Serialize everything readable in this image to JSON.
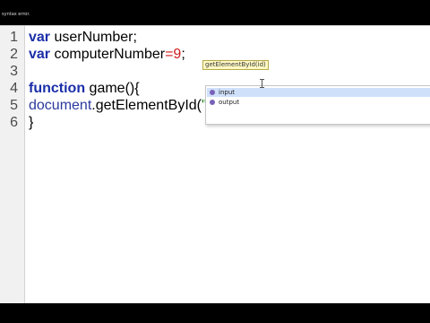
{
  "window": {
    "title_fragment": "syntax error."
  },
  "editor": {
    "line_numbers": [
      "1",
      "2",
      "3",
      "4",
      "5",
      "6"
    ],
    "lines": {
      "l1": {
        "kw": "var",
        "text": " userNumber;"
      },
      "l2": {
        "kw": "var",
        "ident": " computerNumber",
        "op": "=",
        "num": "9",
        "end": ";"
      },
      "l4": {
        "kw": "function",
        "text": " game(){"
      },
      "l5": {
        "obj": "document",
        "text": ".getElementById(",
        "str": "\"\""
      },
      "l6": {
        "text": "}"
      }
    }
  },
  "autocomplete": {
    "tooltip": "getElementById(id)",
    "items": [
      {
        "label": "input",
        "selected": true,
        "icon": "element-icon"
      },
      {
        "label": "output",
        "selected": false,
        "icon": "element-icon"
      }
    ]
  },
  "colors": {
    "keyword": "#1b2fa8",
    "number": "#d11c1c",
    "string": "#1a8a1a",
    "selection": "#cfe0fb"
  }
}
